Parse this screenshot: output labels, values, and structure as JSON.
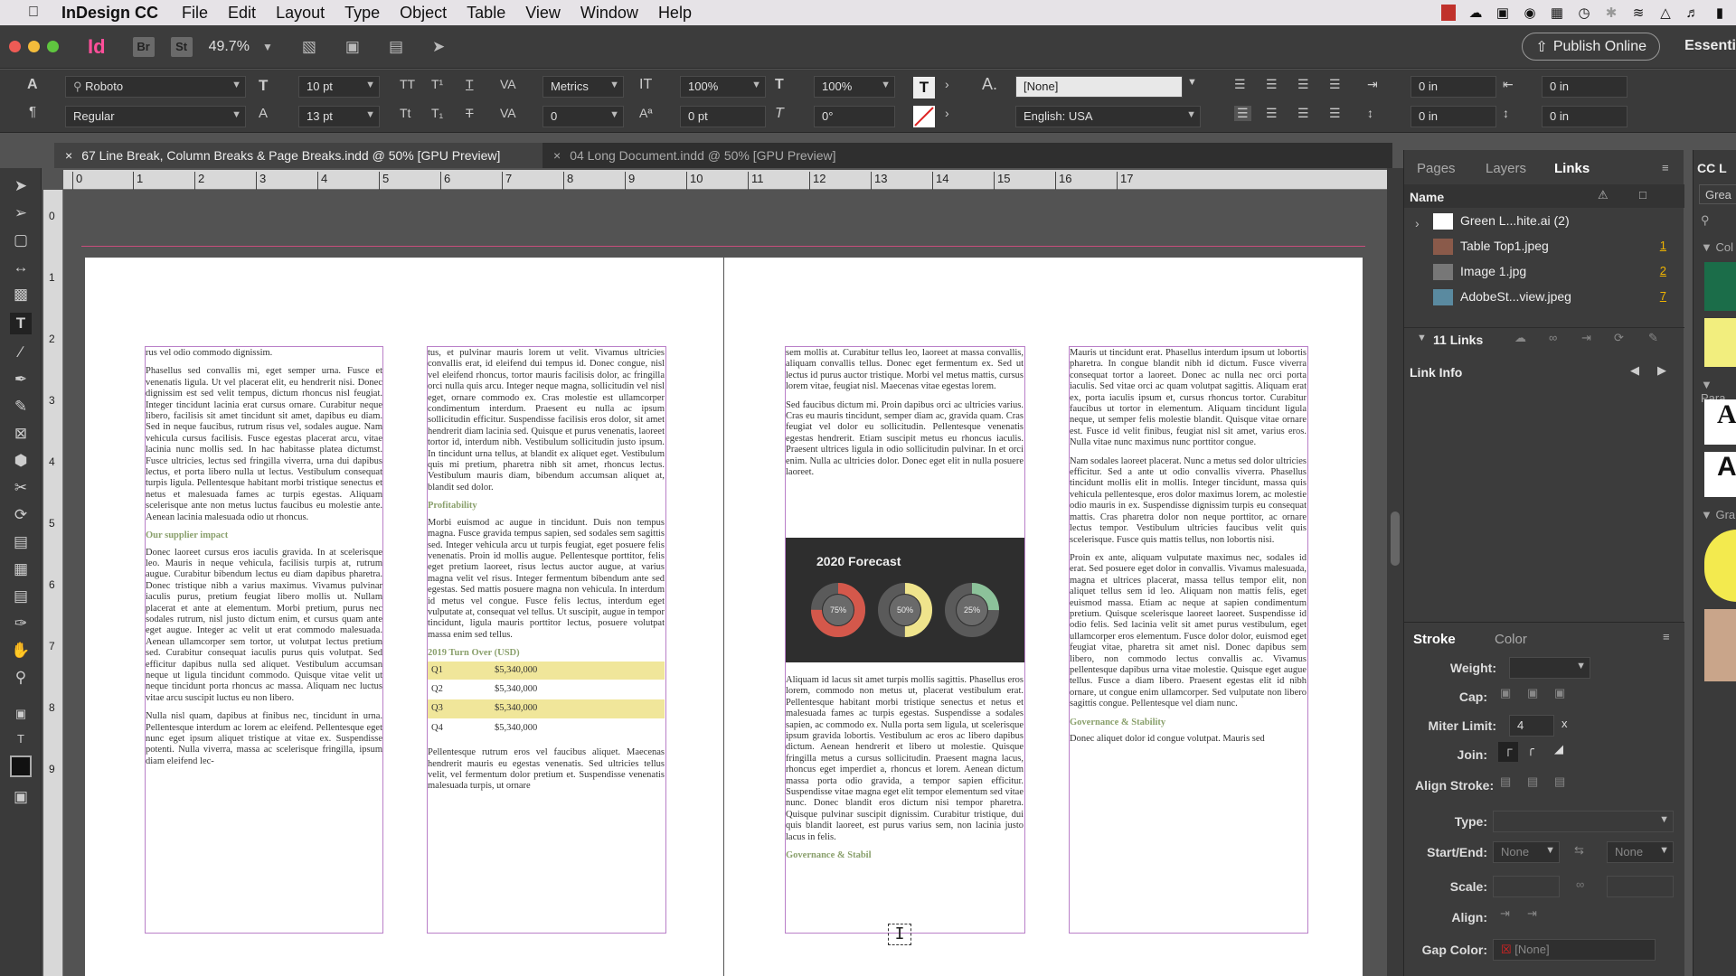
{
  "menubar": {
    "app": "InDesign CC",
    "items": [
      "File",
      "Edit",
      "Layout",
      "Type",
      "Object",
      "Table",
      "View",
      "Window",
      "Help"
    ]
  },
  "appbar": {
    "logo": "Id",
    "br": "Br",
    "st": "St",
    "zoom": "49.7%",
    "publish": "Publish Online",
    "workspace": "Essenti"
  },
  "control": {
    "font_family": "Roboto",
    "font_style": "Regular",
    "font_size": "10 pt",
    "leading": "13 pt",
    "kerning": "Metrics",
    "tracking": "0",
    "vscale": "100%",
    "hscale": "100%",
    "baseline": "0 pt",
    "skew": "0°",
    "char_style": "[None]",
    "language": "English: USA",
    "indent_left": "0 in",
    "indent_right": "0 in",
    "space_before": "0 in",
    "space_after": "0 in"
  },
  "tabs": [
    {
      "label": "67 Line Break, Column Breaks & Page Breaks.indd @ 50% [GPU Preview]",
      "close": "×"
    },
    {
      "label": "04 Long Document.indd @ 50% [GPU Preview]",
      "close": "×"
    }
  ],
  "ruler": {
    "h": [
      "0",
      "1",
      "2",
      "3",
      "4",
      "5",
      "6",
      "7",
      "8",
      "9",
      "10",
      "11",
      "12",
      "13",
      "14",
      "15",
      "16",
      "17"
    ],
    "v": [
      "0",
      "1",
      "2",
      "3",
      "4",
      "5",
      "6",
      "7",
      "8",
      "9"
    ]
  },
  "document": {
    "p1c1": {
      "p0": "rus vel odio commodo dignissim.",
      "p1": "Phasellus sed convallis mi, eget semper urna. Fusce et venenatis ligula. Ut vel placerat elit, eu hendrerit nisi. Donec dignissim est sed velit tempus, dictum rhoncus nisl feugiat. Integer tincidunt lacinia erat cursus ornare. Curabitur neque libero, facilisis sit amet tincidunt sit amet, dapibus eu diam. Sed in neque faucibus, rutrum risus vel, sodales augue. Nam vehicula cursus facilisis. Fusce egestas placerat arcu, vitae lacinia nunc mollis sed. In hac habitasse platea dictumst. Fusce ultricies, lectus sed fringilla viverra, urna dui dapibus lectus, et porta libero nulla ut lectus. Vestibulum consequat turpis ligula. Pellentesque habitant morbi tristique senectus et netus et malesuada fames ac turpis egestas. Aliquam scelerisque ante non metus luctus faucibus eu molestie ante. Aenean lacinia malesuada odio ut rhoncus.",
      "h1": "Our supplier impact",
      "p2": "Donec laoreet cursus eros iaculis gravida. In at scelerisque leo. Mauris in neque vehicula, facilisis turpis at, rutrum augue. Curabitur bibendum lectus eu diam dapibus pharetra. Donec tristique nibh a varius maximus. Vivamus pulvinar iaculis purus, pretium feugiat libero mollis ut. Nullam placerat et ante at elementum. Morbi pretium, purus nec sodales rutrum, nisl justo dictum enim, et cursus quam ante eget augue. Integer ac velit ut erat commodo malesuada. Aenean ullamcorper sem tortor, ut volutpat lectus pretium sed. Curabitur consequat iaculis purus quis volutpat. Sed efficitur dapibus nulla sed aliquet. Vestibulum accumsan neque ut ligula tincidunt commodo. Quisque vitae velit ut neque tincidunt porta rhoncus ac massa. Aliquam nec luctus vitae arcu suscipit luctus eu non libero.",
      "p3": "Nulla nisl quam, dapibus at finibus nec, tincidunt in urna. Pellentesque interdum ac lorem ac eleifend. Pellentesque eget nunc eget ipsum aliquet tristique at vitae ex. Suspendisse potenti. Nulla viverra, massa ac scelerisque fringilla, ipsum diam eleifend lec-"
    },
    "p1c2": {
      "p1": "tus, et pulvinar mauris lorem ut velit. Vivamus ultricies convallis erat, id eleifend dui tempus id. Donec congue, nisl vel eleifend rhoncus, tortor mauris facilisis dolor, ac fringilla orci nulla quis arcu. Integer neque magna, sollicitudin vel nisl eget, ornare commodo ex. Cras molestie est ullamcorper condimentum interdum. Praesent eu nulla ac ipsum sollicitudin efficitur. Suspendisse facilisis eros dolor, sit amet hendrerit diam lacinia sed. Quisque et purus venenatis, laoreet tortor id, interdum nibh. Vestibulum sollicitudin justo ipsum. In tincidunt urna tellus, at blandit ex aliquet eget. Vestibulum quis mi pretium, pharetra nibh sit amet, rhoncus lectus. Vestibulum mauris diam, bibendum accumsan aliquet at, blandit sed dolor.",
      "h1": "Profitability",
      "p2": "Morbi euismod ac augue in tincidunt. Duis non tempus magna. Fusce gravida tempus sapien, sed sodales sem sagittis sed. Integer vehicula arcu ut turpis feugiat, eget posuere felis venenatis. Proin id mollis augue. Pellentesque porttitor, felis eget pretium laoreet, risus lectus auctor augue, at varius magna velit vel risus. Integer fermentum bibendum ante sed egestas. Sed mattis posuere magna non vehicula. In interdum id metus vel congue. Fusce felis lectus, interdum eget vulputate at, consequat vel tellus. Ut suscipit, augue in tempor tincidunt, ligula mauris porttitor lectus, posuere volutpat massa enim sed tellus.",
      "table_title": "2019 Turn Over (USD)",
      "table": [
        {
          "q": "Q1",
          "v": "$5,340,000"
        },
        {
          "q": "Q2",
          "v": "$5,340,000"
        },
        {
          "q": "Q3",
          "v": "$5,340,000"
        },
        {
          "q": "Q4",
          "v": "$5,340,000"
        }
      ],
      "p3": "Pellentesque rutrum eros vel faucibus aliquet. Maecenas hendrerit mauris eu egestas venenatis. Sed ultricies tellus velit, vel fermentum dolor pretium et. Suspendisse venenatis malesuada turpis, ut ornare"
    },
    "p2c1": {
      "p1": "sem mollis at. Curabitur tellus leo, laoreet at massa convallis, aliquam convallis tellus. Donec eget fermentum ex. Sed ut lectus id purus auctor tristique. Morbi vel metus mattis, cursus lorem vitae, feugiat nisl. Maecenas vitae egestas lorem.",
      "p2": "Sed faucibus dictum mi. Proin dapibus orci ac ultricies varius. Cras eu mauris tincidunt, semper diam ac, gravida quam. Cras feugiat vel dolor eu sollicitudin. Pellentesque venenatis egestas hendrerit. Etiam suscipit metus eu rhoncus iaculis. Praesent ultrices ligula in odio sollicitudin pulvinar. In et orci enim. Nulla ac ultricies dolor. Donec eget elit in nulla posuere laoreet.",
      "forecast_title": "2020 Forecast",
      "donuts": [
        {
          "label": "75%",
          "value": 75,
          "color": "#d4584b"
        },
        {
          "label": "50%",
          "value": 50,
          "color": "#efe48c"
        },
        {
          "label": "25%",
          "value": 25,
          "color": "#8cc29a"
        }
      ],
      "p3": "Aliquam id lacus sit amet turpis mollis sagittis. Phasellus eros lorem, commodo non metus ut, placerat vestibulum erat. Pellentesque habitant morbi tristique senectus et netus et malesuada fames ac turpis egestas. Suspendisse a sodales sapien, ac commodo ex. Nulla porta sem ligula, ut scelerisque ipsum gravida lobortis. Vestibulum ac eros ac libero dapibus dictum. Aenean hendrerit et libero ut molestie. Quisque fringilla metus a cursus sollicitudin. Praesent magna lacus, rhoncus eget imperdiet a, rhoncus et lorem. Aenean dictum massa porta odio gravida, a tempor sapien efficitur. Suspendisse vitae magna eget elit tempor elementum sed vitae nunc. Donec blandit eros dictum nisi tempor pharetra. Quisque pulvinar suscipit dignissim. Curabitur tristique, dui quis blandit laoreet, est purus varius sem, non lacinia justo lacus in felis.",
      "h1": "Governance & Stabil"
    },
    "p2c2": {
      "p1": "Mauris ut tincidunt erat. Phasellus interdum ipsum ut lobortis pharetra. In congue blandit nibh id dictum. Fusce viverra consequat tortor a laoreet. Donec ac nulla nec orci porta iaculis. Sed vitae orci ac quam volutpat sagittis. Aliquam erat ex, porta iaculis ipsum et, cursus rhoncus tortor. Curabitur faucibus ut tortor in elementum. Aliquam tincidunt ligula neque, ut semper felis molestie blandit. Quisque vitae ornare est. Fusce id velit finibus, feugiat nisl sit amet, varius eros. Nulla vitae nunc maximus nunc porttitor congue.",
      "p2": "Nam sodales laoreet placerat. Nunc a metus sed dolor ultricies efficitur. Sed a ante ut odio convallis viverra. Phasellus tincidunt mollis elit in mollis. Integer tincidunt, massa quis vehicula pellentesque, eros dolor maximus lorem, ac molestie odio mauris in ex. Suspendisse dignissim turpis eu consequat mattis. Cras pharetra dolor non neque porttitor, ac ornare lectus tempor. Vestibulum ultricies faucibus velit quis scelerisque. Fusce quis mattis tellus, non lobortis nisi.",
      "p3": "Proin ex ante, aliquam vulputate maximus nec, sodales id erat. Sed posuere eget dolor in convallis. Vivamus malesuada, magna et ultrices placerat, massa tellus tempor elit, non aliquet tellus sem id leo. Aliquam non mattis felis, eget euismod massa. Etiam ac neque at sapien condimentum pretium. Quisque scelerisque laoreet laoreet. Suspendisse id odio felis. Sed lacinia velit sit amet purus vestibulum, eget ullamcorper eros elementum. Fusce dolor dolor, euismod eget feugiat vitae, pharetra sit amet nisl. Donec dapibus sem libero, non commodo lectus convallis ac. Vivamus pellentesque dapibus urna vitae molestie. Quisque eget augue tellus. Fusce a diam libero. Praesent egestas elit id nibh ornare, ut congue enim ullamcorper. Sed vulputate non libero sagittis congue. Pellentesque vel diam nunc.",
      "h1": "Governance & Stability",
      "p4": "Donec aliquet dolor id congue volutpat. Mauris sed"
    }
  },
  "links_panel": {
    "tabs": [
      "Pages",
      "Layers",
      "Links"
    ],
    "name_header": "Name",
    "rows": [
      {
        "name": "Green L...hite.ai (2)",
        "page": "",
        "color": "#ffffff"
      },
      {
        "name": "Table Top1.jpeg",
        "page": "1",
        "color": "#8a5a4a"
      },
      {
        "name": "Image 1.jpg",
        "page": "2",
        "color": "#777777"
      },
      {
        "name": "AdobeSt...view.jpeg",
        "page": "7",
        "color": "#5a8aa0"
      }
    ],
    "count": "11 Links",
    "link_info": "Link Info"
  },
  "stroke_panel": {
    "tabs": [
      "Stroke",
      "Color"
    ],
    "weight": "Weight:",
    "cap": "Cap:",
    "miter": "Miter Limit:",
    "miter_value": "4",
    "miter_x": "x",
    "join": "Join:",
    "align": "Align Stroke:",
    "type": "Type:",
    "startend": "Start/End:",
    "start_value": "None",
    "end_value": "None",
    "scale": "Scale:",
    "align2": "Align:",
    "gapcolor": "Gap Color:",
    "gap_value": "[None]"
  },
  "far_right": {
    "cc": "CC L",
    "grea": "Grea",
    "col": "Col",
    "para": "Para",
    "gra": "Gra",
    "glyph1": "A",
    "glyph2": "A"
  }
}
